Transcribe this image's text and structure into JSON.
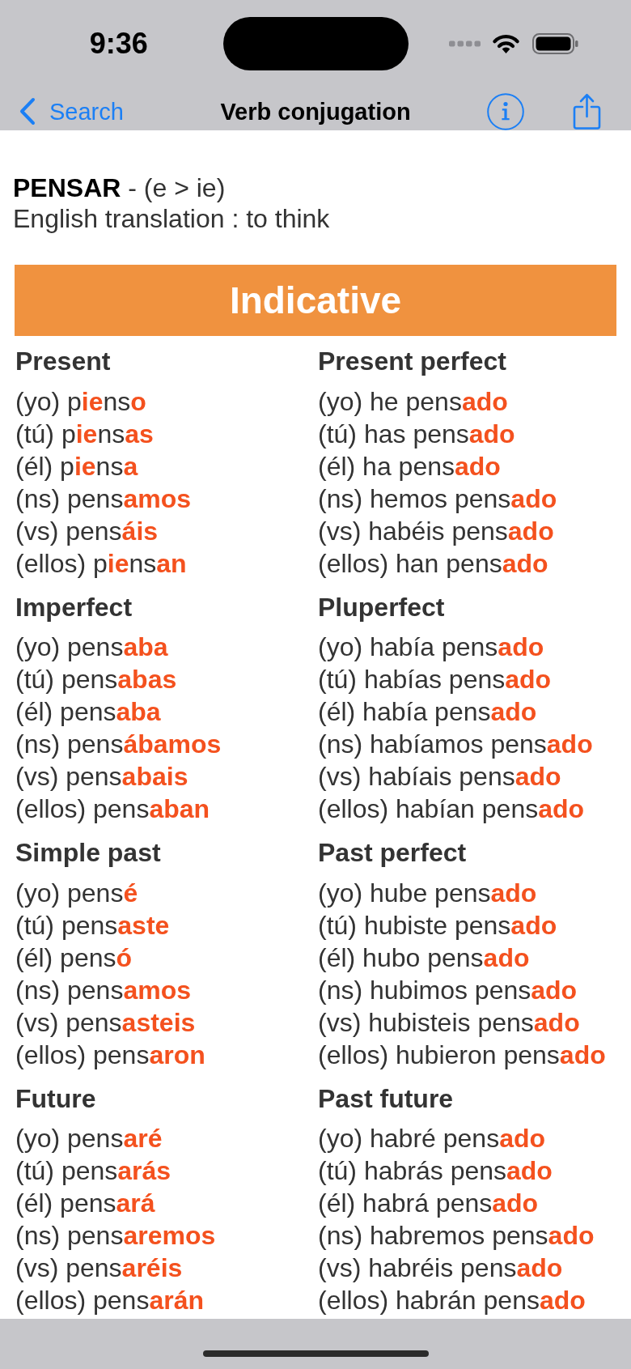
{
  "status_bar": {
    "time": "9:36"
  },
  "nav_bar": {
    "back_label": "Search",
    "title": "Verb conjugation"
  },
  "verb": {
    "heading": "**PENSAR** - (e > ie)",
    "translation": "English translation : to think"
  },
  "mood": {
    "title": "Indicative",
    "tenses": [
      {
        "name": "Present",
        "forms": [
          "(yo) p**ie**ns**o**",
          "(tú) p**ie**ns**as**",
          "(él) p**ie**ns**a**",
          "(ns) pens**amos**",
          "(vs) pens**áis**",
          "(ellos) p**ie**ns**an**"
        ]
      },
      {
        "name": "Present perfect",
        "forms": [
          "(yo) he pens**ado**",
          "(tú) has pens**ado**",
          "(él) ha pens**ado**",
          "(ns) hemos pens**ado**",
          "(vs) habéis pens**ado**",
          "(ellos) han pens**ado**"
        ]
      },
      {
        "name": "Imperfect",
        "forms": [
          "(yo) pens**aba**",
          "(tú) pens**abas**",
          "(él) pens**aba**",
          "(ns) pens**ábamos**",
          "(vs) pens**abais**",
          "(ellos) pens**aban**"
        ]
      },
      {
        "name": "Pluperfect",
        "forms": [
          "(yo) había pens**ado**",
          "(tú) habías pens**ado**",
          "(él) había pens**ado**",
          "(ns) habíamos pens**ado**",
          "(vs) habíais pens**ado**",
          "(ellos) habían pens**ado**"
        ]
      },
      {
        "name": "Simple past",
        "forms": [
          "(yo) pens**é**",
          "(tú) pens**aste**",
          "(él) pens**ó**",
          "(ns) pens**amos**",
          "(vs) pens**asteis**",
          "(ellos) pens**aron**"
        ]
      },
      {
        "name": "Past perfect",
        "forms": [
          "(yo) hube pens**ado**",
          "(tú) hubiste pens**ado**",
          "(él) hubo pens**ado**",
          "(ns) hubimos pens**ado**",
          "(vs) hubisteis pens**ado**",
          "(ellos) hubieron pens**ado**"
        ]
      },
      {
        "name": "Future",
        "forms": [
          "(yo) pens**aré**",
          "(tú) pens**arás**",
          "(él) pens**ará**",
          "(ns) pens**aremos**",
          "(vs) pens**aréis**",
          "(ellos) pens**arán**"
        ]
      },
      {
        "name": "Past future",
        "forms": [
          "(yo) habré pens**ado**",
          "(tú) habrás pens**ado**",
          "(él) habrá pens**ado**",
          "(ns) habremos pens**ado**",
          "(vs) habréis pens**ado**",
          "(ellos) habrán pens**ado**"
        ]
      }
    ]
  }
}
